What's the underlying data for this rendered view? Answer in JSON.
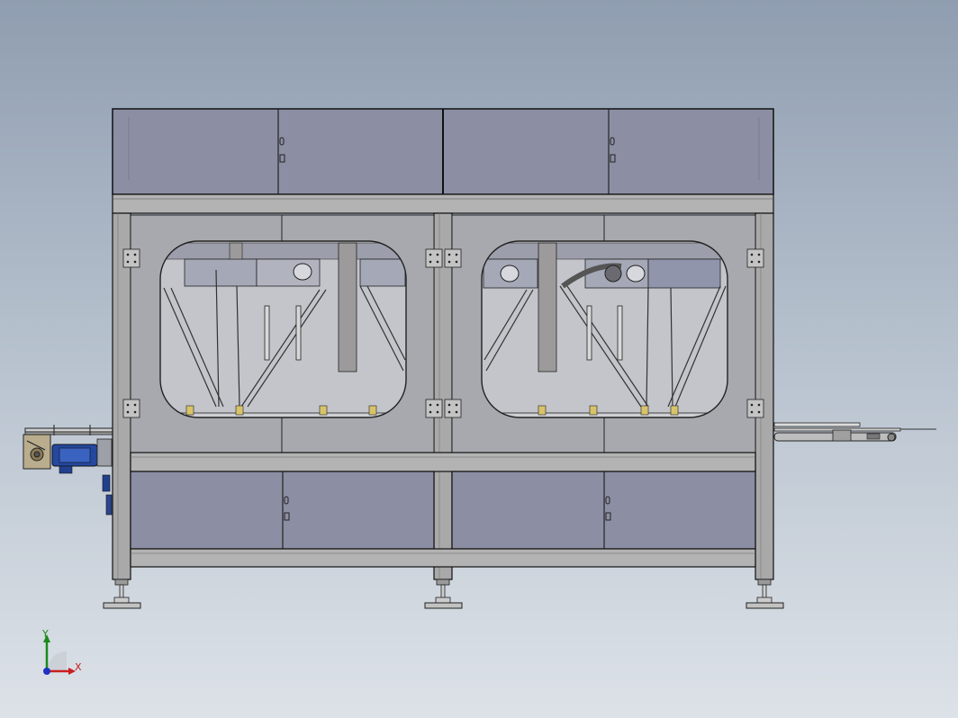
{
  "view": {
    "background_top": "#8f9db0",
    "background_bottom": "#dde2e8"
  },
  "colors": {
    "panel": "#8c8fa3",
    "frame": "#a8a8a8",
    "frame_dark": "#7d7d7d",
    "outline": "#1e1e1e",
    "window_glass": "#b6b9c2",
    "motor_blue": "#2448a0"
  },
  "triad": {
    "y_label": "Y",
    "x_label": "X",
    "y_color": "#1a8a1a",
    "x_color": "#c81e1e",
    "z_color": "#2030c0"
  },
  "model": {
    "cabinet_count": 2,
    "robot_count": 4,
    "leveling_feet": 3,
    "upper_doors": 4,
    "lower_doors": 4
  }
}
